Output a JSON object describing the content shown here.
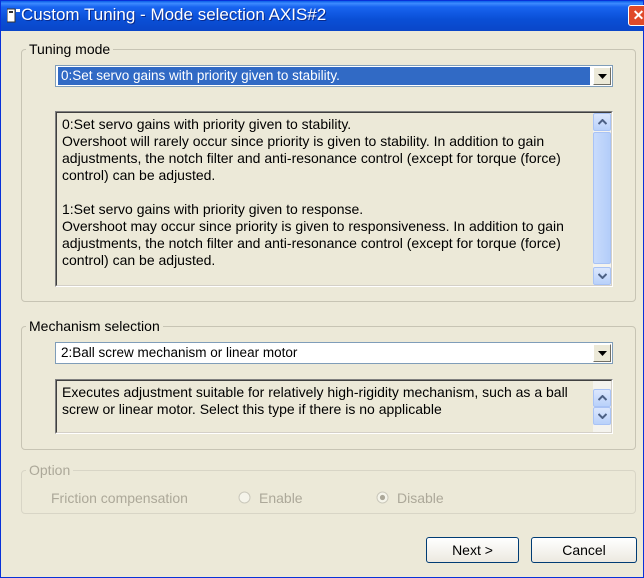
{
  "window": {
    "title": "Custom Tuning - Mode selection AXIS#2",
    "close_icon": "close-icon"
  },
  "tuning_mode": {
    "group_label": "Tuning mode",
    "selected": "0:Set servo gains with priority given to stability.",
    "description": [
      "0:Set servo gains with priority given to stability.\nOvershoot will rarely occur since priority is given to stability. In addition to gain adjustments, the notch filter and anti-resonance control (except for torque (force) control) can be adjusted.",
      "1:Set servo gains with priority given to response.\nOvershoot may occur since priority is given to responsiveness. In addition to gain adjustments, the notch filter and anti-resonance control (except for torque (force) control) can be adjusted."
    ]
  },
  "mechanism": {
    "group_label": "Mechanism selection",
    "selected": "2:Ball screw mechanism or linear motor",
    "description": "Executes adjustment suitable for relatively high-rigidity mechanism, such as a ball screw or linear motor. Select this type if there is no applicable"
  },
  "option": {
    "group_label": "Option",
    "friction_label": "Friction compensation",
    "enable_label": "Enable",
    "disable_label": "Disable",
    "selected": "Disable"
  },
  "buttons": {
    "next": "Next >",
    "cancel": "Cancel"
  },
  "colors": {
    "titlebar": "#0a4fd6",
    "selection": "#316ac5",
    "window_bg": "#ece9d8",
    "disabled_text": "#aca899"
  }
}
